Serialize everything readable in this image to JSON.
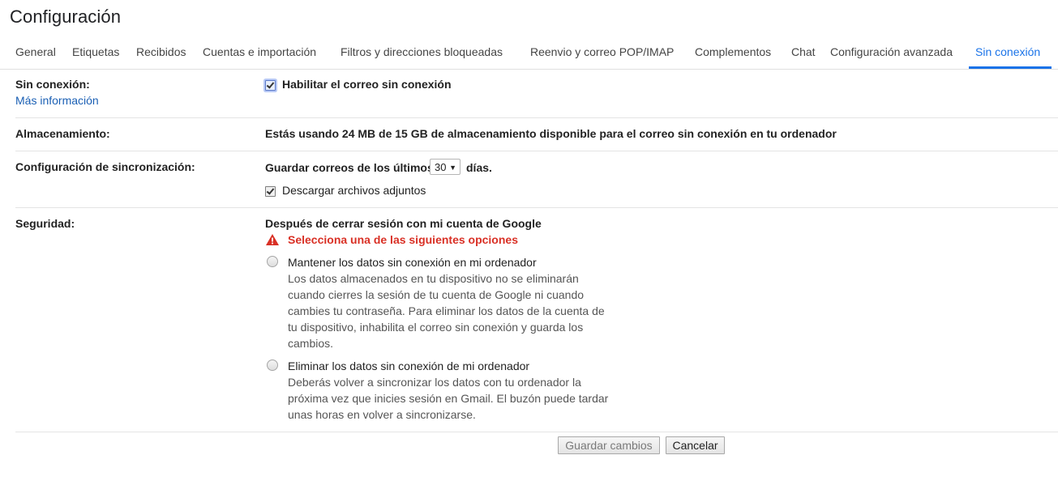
{
  "page": {
    "title": "Configuración"
  },
  "tabs": [
    {
      "label": "General"
    },
    {
      "label": "Etiquetas"
    },
    {
      "label": "Recibidos"
    },
    {
      "label": "Cuentas e importación"
    },
    {
      "label": "Filtros y direcciones bloqueadas"
    },
    {
      "label": "Reenvio y correo POP/IMAP"
    },
    {
      "label": "Complementos"
    },
    {
      "label": "Chat"
    },
    {
      "label": "Configuración avanzada"
    },
    {
      "label": "Sin conexión",
      "active": true
    }
  ],
  "offline": {
    "label": "Sin conexión:",
    "more_info": "Más información",
    "enable_label": "Habilitar el correo sin conexión",
    "enabled": true
  },
  "storage": {
    "label": "Almacenamiento:",
    "text": "Estás usando 24 MB de 15 GB de almacenamiento disponible para el correo sin conexión en tu ordenador"
  },
  "sync": {
    "label": "Configuración de sincronización:",
    "prefix": "Guardar correos de los últimos",
    "days_value": "30",
    "suffix": "días.",
    "attachments_label": "Descargar archivos adjuntos",
    "attachments_checked": true
  },
  "security": {
    "label": "Seguridad:",
    "heading": "Después de cerrar sesión con mi cuenta de Google",
    "warning": "Selecciona una de las siguientes opciones",
    "options": [
      {
        "title": "Mantener los datos sin conexión en mi ordenador",
        "desc": [
          "Los datos almacenados en tu dispositivo no se eliminarán",
          "cuando cierres la sesión de tu cuenta de Google ni cuando",
          "cambies tu contraseña. Para eliminar los datos de la cuenta de",
          "tu dispositivo, inhabilita el correo sin conexión y guarda los",
          "cambios."
        ]
      },
      {
        "title": "Eliminar los datos sin conexión de mi ordenador",
        "desc": [
          "Deberás volver a sincronizar los datos con tu ordenador la",
          "próxima vez que inicies sesión en Gmail. El buzón puede tardar",
          "unas horas en volver a sincronizarse."
        ]
      }
    ]
  },
  "buttons": {
    "save": "Guardar cambios",
    "cancel": "Cancelar"
  },
  "colors": {
    "accent": "#1a73e8",
    "warning": "#d93025",
    "link": "#1a5fb4"
  },
  "icons": {
    "warning": "warning-triangle-icon",
    "checkbox": "checkmark-icon",
    "select": "chevron-down-icon"
  }
}
